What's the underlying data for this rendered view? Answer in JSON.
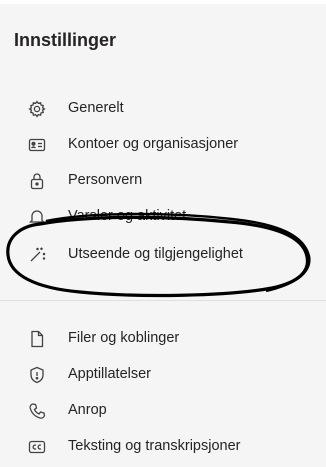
{
  "header": {
    "title": "Innstillinger"
  },
  "sidebar": {
    "items": [
      {
        "label": "Generelt",
        "icon": "gear-icon"
      },
      {
        "label": "Kontoer og organisasjoner",
        "icon": "id-card-icon"
      },
      {
        "label": "Personvern",
        "icon": "lock-icon"
      },
      {
        "label": "Varsler og aktivitet",
        "icon": "bell-icon"
      },
      {
        "label": "Utseende og tilgjengelighet",
        "icon": "magic-wand-icon"
      },
      {
        "label": "Filer og koblinger",
        "icon": "file-icon"
      },
      {
        "label": "Apptillatelser",
        "icon": "shield-icon"
      },
      {
        "label": "Anrop",
        "icon": "phone-icon"
      },
      {
        "label": "Teksting og transkripsjoner",
        "icon": "closed-captions-icon"
      }
    ]
  },
  "colors": {
    "background": "#f5f5f5",
    "text": "#252423",
    "annotation": "#000000"
  }
}
